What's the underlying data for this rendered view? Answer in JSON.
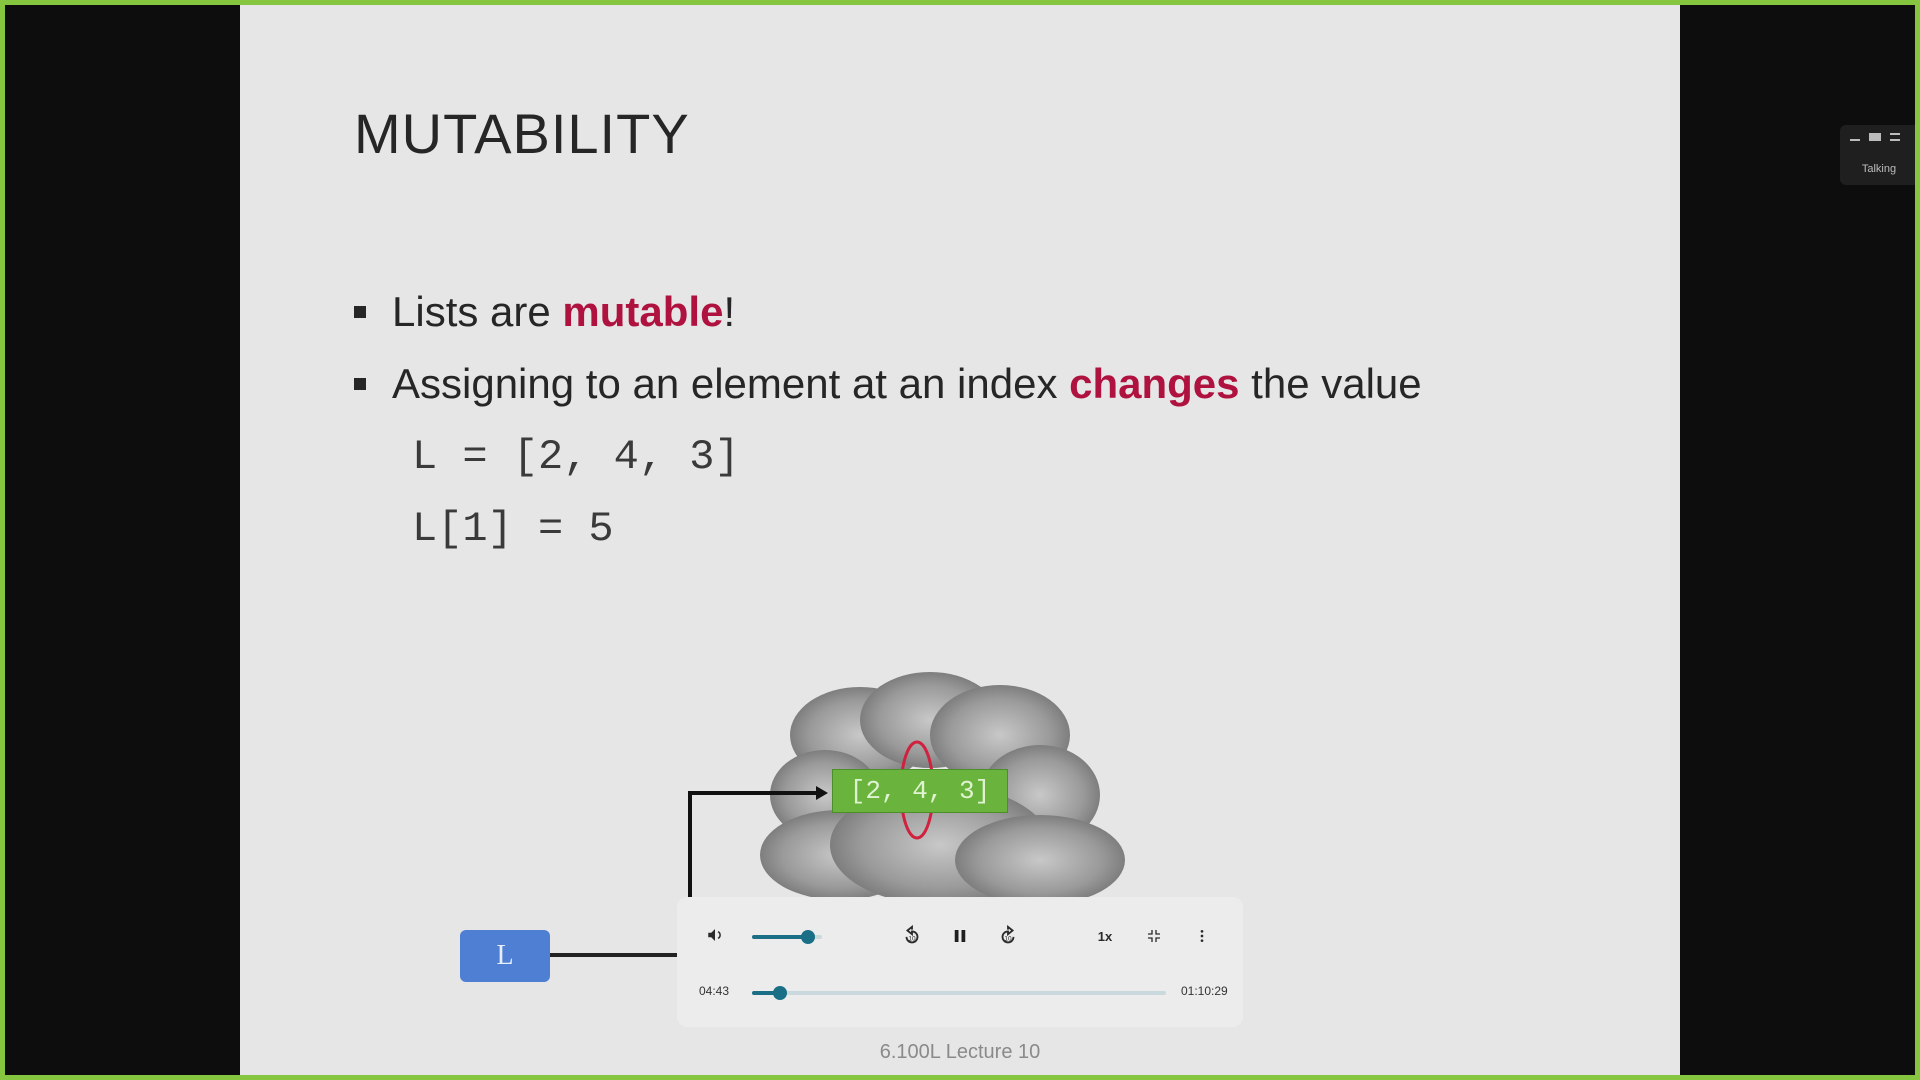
{
  "slide": {
    "title": "MUTABILITY",
    "bullet1_prefix": "Lists are ",
    "bullet1_emph": "mutable",
    "bullet1_suffix": "!",
    "bullet2_prefix": "Assigning to an element at an index ",
    "bullet2_emph": "changes",
    "bullet2_suffix": " the value",
    "code_line1": "L = [2, 4, 3]",
    "code_line2": "L[1] = 5",
    "diagram": {
      "variable_label": "L",
      "list_label": "[2, 4, 3]"
    },
    "footer": "6.100L Lecture 10",
    "accent_color": "#b0123f"
  },
  "player": {
    "current_time": "04:43",
    "total_time": "01:10:29",
    "speed": "1x",
    "volume_fraction": 0.8,
    "progress_fraction": 0.067
  },
  "widget": {
    "label": "Talking"
  },
  "icons": [
    "volume-icon",
    "rewind-10-icon",
    "pause-icon",
    "forward-10-icon",
    "exit-fullscreen-icon",
    "more-icon",
    "minimize-icon",
    "window-icon",
    "menu-icon"
  ]
}
